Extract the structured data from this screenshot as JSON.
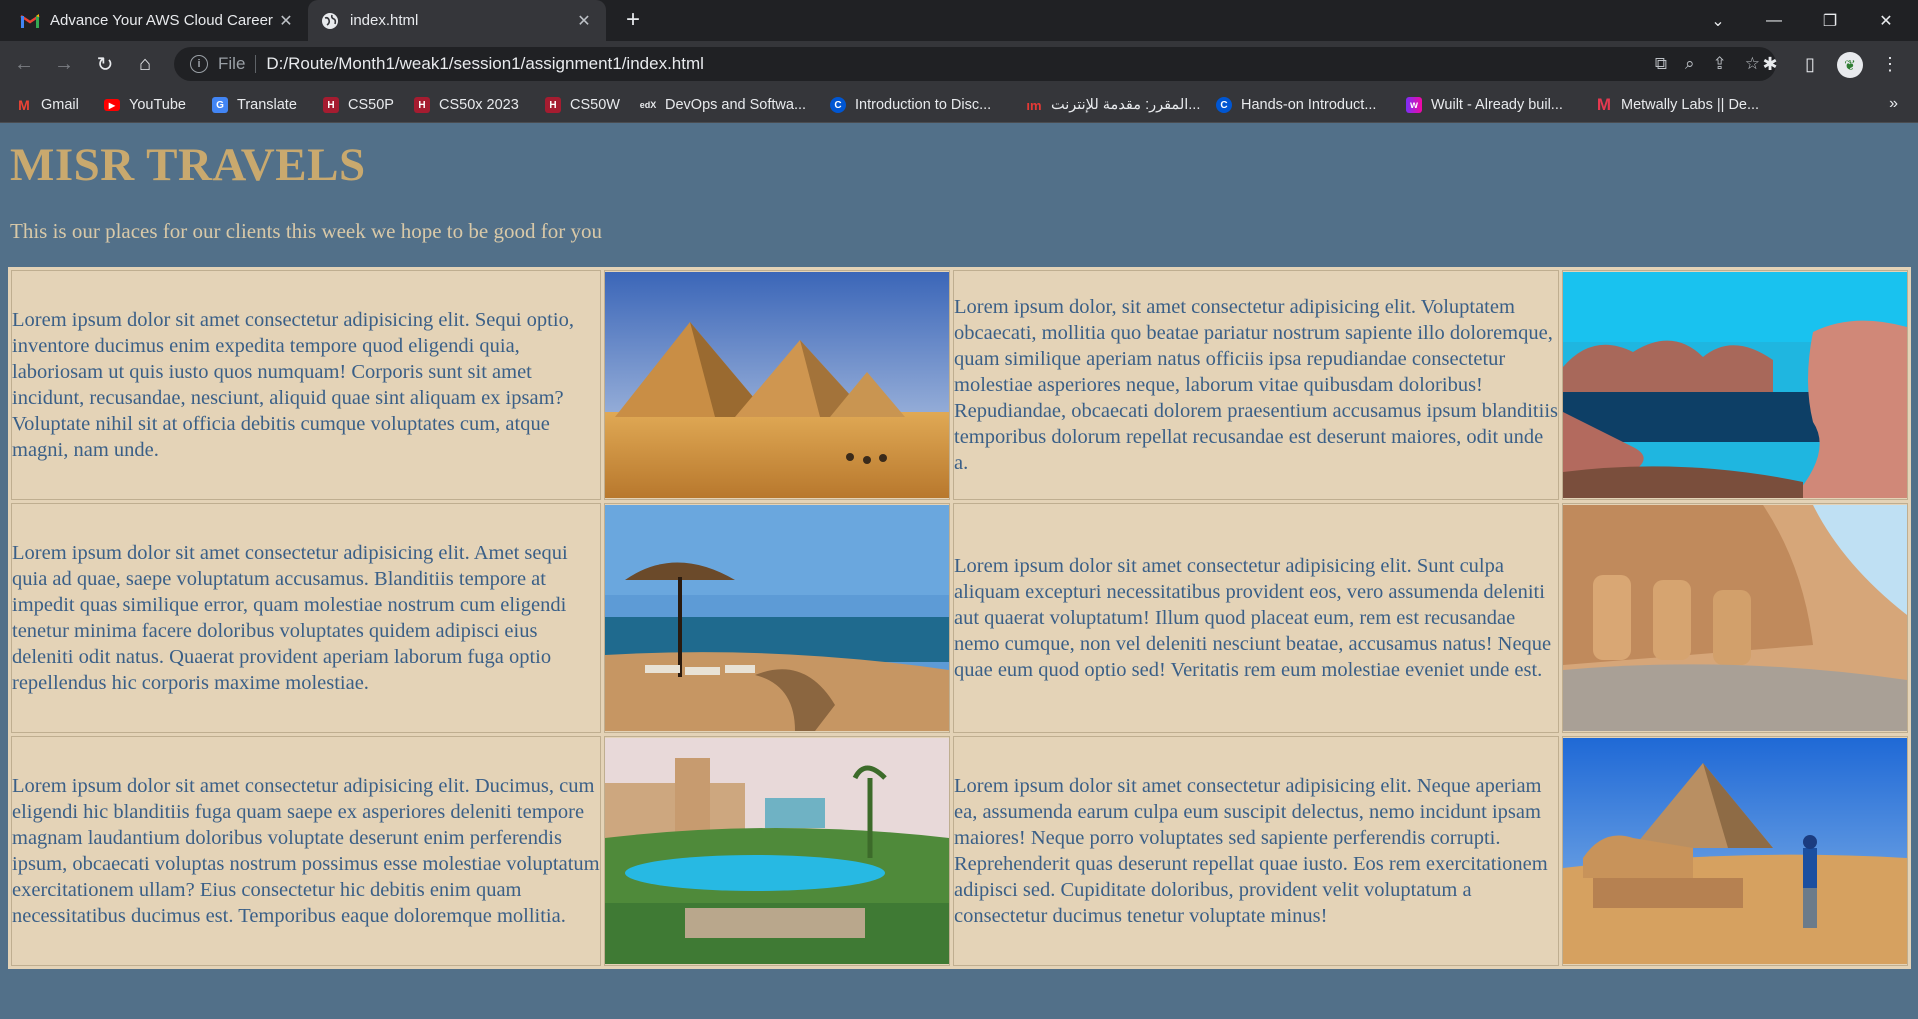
{
  "browser": {
    "tabs": [
      {
        "title": "Advance Your AWS Cloud Career",
        "icon": "gmail-icon"
      },
      {
        "title": "index.html",
        "icon": "globe-icon",
        "active": true
      }
    ],
    "address": {
      "scheme_label": "File",
      "url": "D:/Route/Month1/weak1/session1/assignment1/index.html"
    },
    "bookmarks": [
      {
        "label": "Gmail",
        "icon": "gmail-icon"
      },
      {
        "label": "YouTube",
        "icon": "youtube-icon"
      },
      {
        "label": "Translate",
        "icon": "translate-icon"
      },
      {
        "label": "CS50P",
        "icon": "harvard-icon"
      },
      {
        "label": "CS50x 2023",
        "icon": "harvard-icon"
      },
      {
        "label": "CS50W",
        "icon": "harvard-icon"
      },
      {
        "label": "DevOps and Softwa...",
        "icon": "edx-icon"
      },
      {
        "label": "Introduction to Disc...",
        "icon": "coursera-icon"
      },
      {
        "label": "المقرر: مقدمة للإنترنت...",
        "icon": "edraak-icon"
      },
      {
        "label": "Hands-on Introduct...",
        "icon": "coursera-icon"
      },
      {
        "label": "Wuilt - Already buil...",
        "icon": "wuilt-icon"
      },
      {
        "label": "Metwally Labs || De...",
        "icon": "metwally-icon"
      }
    ]
  },
  "page": {
    "title": "MISR TRAVELS",
    "tagline": "This is our places for our clients this week we hope to be good for you",
    "rows": [
      {
        "text_left": "Lorem ipsum dolor sit amet consectetur adipisicing elit. Sequi optio, inventore ducimus enim expedita tempore quod eligendi quia, laboriosam ut quis iusto quos numquam! Corporis sunt sit amet incidunt, recusandae, nesciunt, aliquid quae sint aliquam ex ipsam? Voluptate nihil sit at officia debitis cumque voluptates cum, atque magni, nam unde.",
        "image_left": "pyramids-desert-photo",
        "text_right": "Lorem ipsum dolor, sit amet consectetur adipisicing elit. Voluptatem obcaecati, mollitia quo beatae pariatur nostrum sapiente illo doloremque, quam similique aperiam natus officiis ipsa repudiandae consectetur molestiae asperiores neque, laborum vitae quibusdam doloribus! Repudiandae, obcaecati dolorem praesentium accusamus ipsum blanditiis temporibus dolorum repellat recusandae est deserunt maiores, odit unde a.",
        "image_right": "lake-rocks-photo"
      },
      {
        "text_left": "Lorem ipsum dolor sit amet consectetur adipisicing elit. Amet sequi quia ad quae, saepe voluptatum accusamus. Blanditiis tempore at impedit quas similique error, quam molestiae nostrum cum eligendi tenetur minima facere doloribus voluptates quidem adipisci eius deleniti odit natus. Quaerat provident aperiam laborum fuga optio repellendus hic corporis maxime molestiae.",
        "image_left": "beach-umbrella-photo",
        "text_right": "Lorem ipsum dolor sit amet consectetur adipisicing elit. Sunt culpa aliquam excepturi necessitatibus provident eos, vero assumenda deleniti aut quaerat voluptatum! Illum quod placeat eum, rem est recusandae nemo cumque, non vel deleniti nesciunt beatae, accusamus natus! Neque quae eum quod optio sed! Veritatis rem eum molestiae eveniet unde est.",
        "image_right": "abu-simbel-temple-photo"
      },
      {
        "text_left": "Lorem ipsum dolor sit amet consectetur adipisicing elit. Ducimus, cum eligendi hic blanditiis fuga quam saepe ex asperiores deleniti tempore magnam laudantium doloribus voluptate deserunt enim perferendis ipsum, obcaecati voluptas nostrum possimus esse molestiae voluptatum exercitationem ullam? Eius consectetur hic debitis enim quam necessitatibus ducimus est. Temporibus eaque doloremque mollitia.",
        "image_left": "resort-pool-photo",
        "text_right": "Lorem ipsum dolor sit amet consectetur adipisicing elit. Neque aperiam ea, assumenda earum culpa eum suscipit delectus, nemo incidunt ipsam maiores! Neque porro voluptates sed sapiente perferendis corrupti. Reprehenderit quas deserunt repellat quae iusto. Eos rem exercitationem adipisci sed. Cupiditate doloribus, provident velit voluptatum a consectetur ducimus tenetur voluptate minus!",
        "image_right": "sphinx-pyramid-photo"
      }
    ]
  }
}
